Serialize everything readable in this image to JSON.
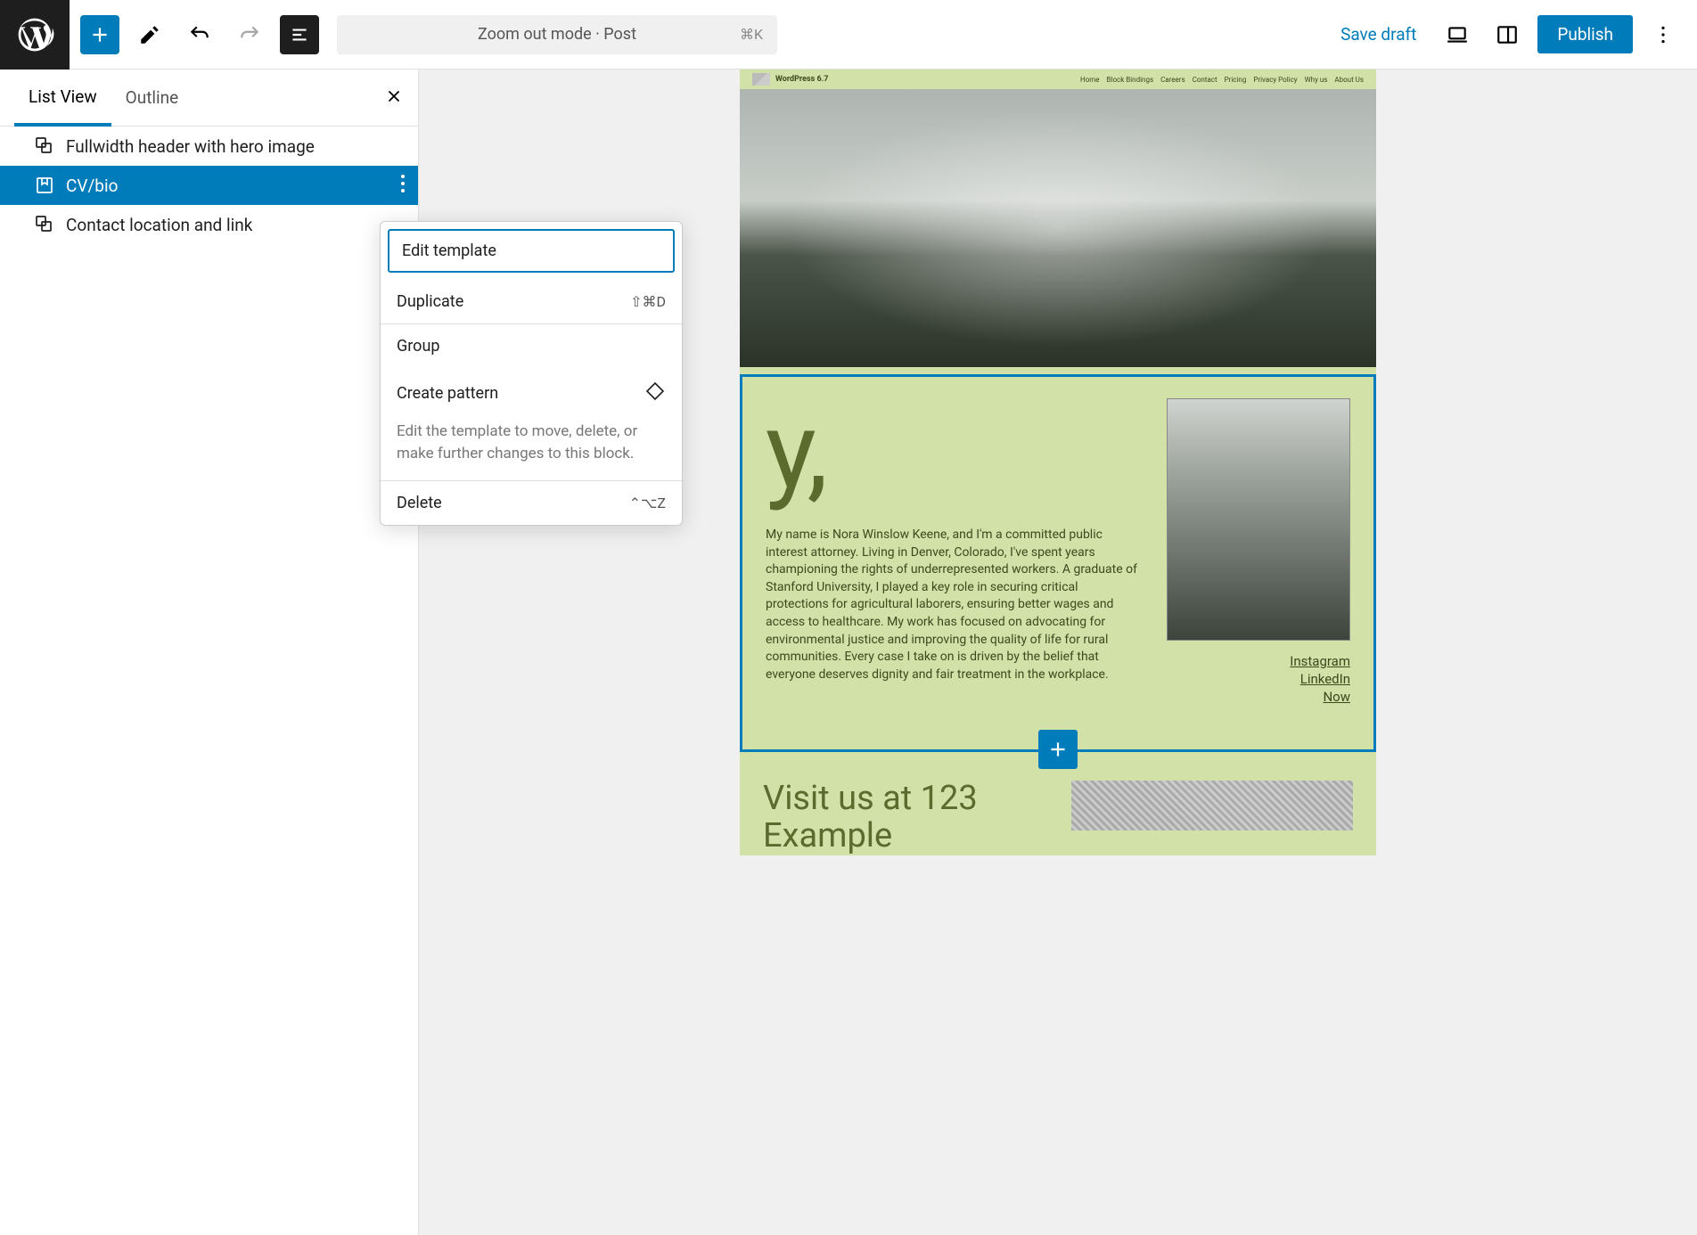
{
  "topbar": {
    "command_label": "Zoom out mode · Post",
    "command_shortcut": "⌘K",
    "save_label": "Save draft",
    "publish_label": "Publish"
  },
  "sidebar": {
    "tabs": [
      "List View",
      "Outline"
    ],
    "active_tab": 0,
    "items": [
      {
        "label": "Fullwidth header with hero image",
        "selected": false
      },
      {
        "label": "CV/bio",
        "selected": true
      },
      {
        "label": "Contact location and link",
        "selected": false
      }
    ]
  },
  "context_menu": {
    "edit_template": "Edit template",
    "duplicate": "Duplicate",
    "duplicate_kbd": "⇧⌘D",
    "group": "Group",
    "create_pattern": "Create pattern",
    "description": "Edit the template to move, delete, or make further changes to this block.",
    "delete": "Delete",
    "delete_kbd": "⌃⌥Z"
  },
  "canvas": {
    "site_title": "WordPress 6.7",
    "nav": [
      "Home",
      "Block Bindings",
      "Careers",
      "Contact",
      "Pricing",
      "Privacy Policy",
      "Why us",
      "About Us"
    ],
    "cv_heading": "y,",
    "cv_body": "My name is Nora Winslow Keene, and I'm a committed public interest attorney. Living in Denver, Colorado, I've spent years championing the rights of underrepresented workers. A graduate of Stanford University, I played a key role in securing critical protections for agricultural laborers, ensuring better wages and access to healthcare. My work has focused on advocating for environmental justice and improving the quality of life for rural communities. Every case I take on is driven by the belief that everyone deserves dignity and fair treatment in the workplace.",
    "social": [
      "Instagram",
      "LinkedIn",
      "Now"
    ],
    "contact_heading": "Visit us at 123 Example"
  }
}
